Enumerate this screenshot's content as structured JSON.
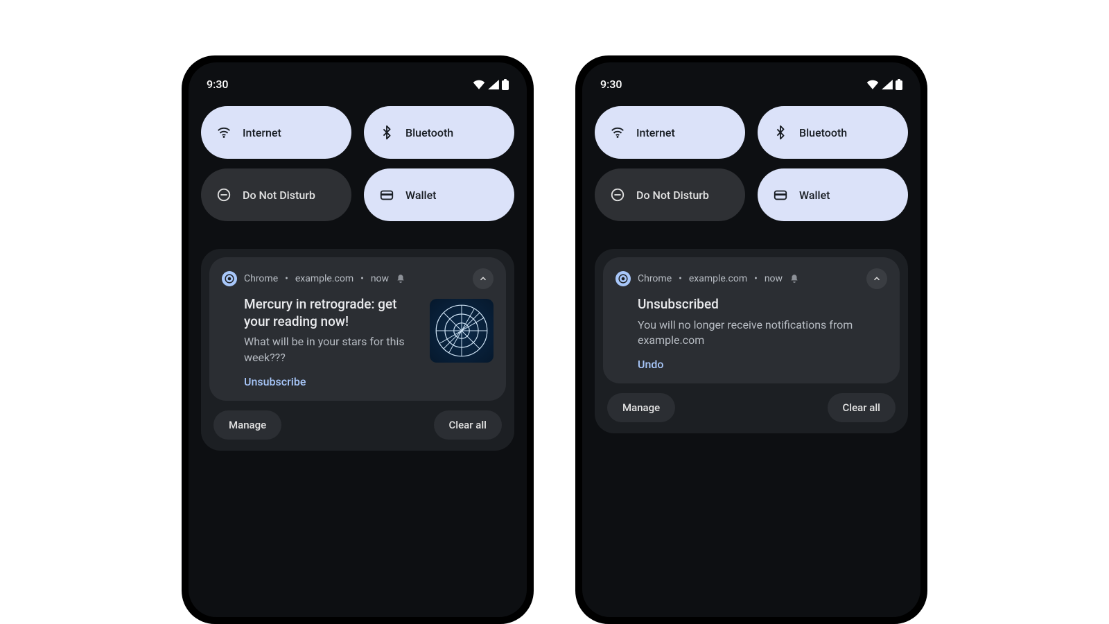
{
  "status": {
    "time": "9:30"
  },
  "qs": {
    "internet": {
      "label": "Internet"
    },
    "bluetooth": {
      "label": "Bluetooth"
    },
    "dnd": {
      "label": "Do Not Disturb"
    },
    "wallet": {
      "label": "Wallet"
    }
  },
  "notif_header": {
    "app": "Chrome",
    "site": "example.com",
    "time": "now"
  },
  "phone_a": {
    "title": "Mercury in retrograde: get your reading now!",
    "subtitle": "What will be in your stars for this week???",
    "action": "Unsubscribe"
  },
  "phone_b": {
    "title": "Unsubscribed",
    "subtitle": "You will no longer receive notifications from example.com",
    "action": "Undo"
  },
  "footer": {
    "manage": "Manage",
    "clear": "Clear all"
  }
}
